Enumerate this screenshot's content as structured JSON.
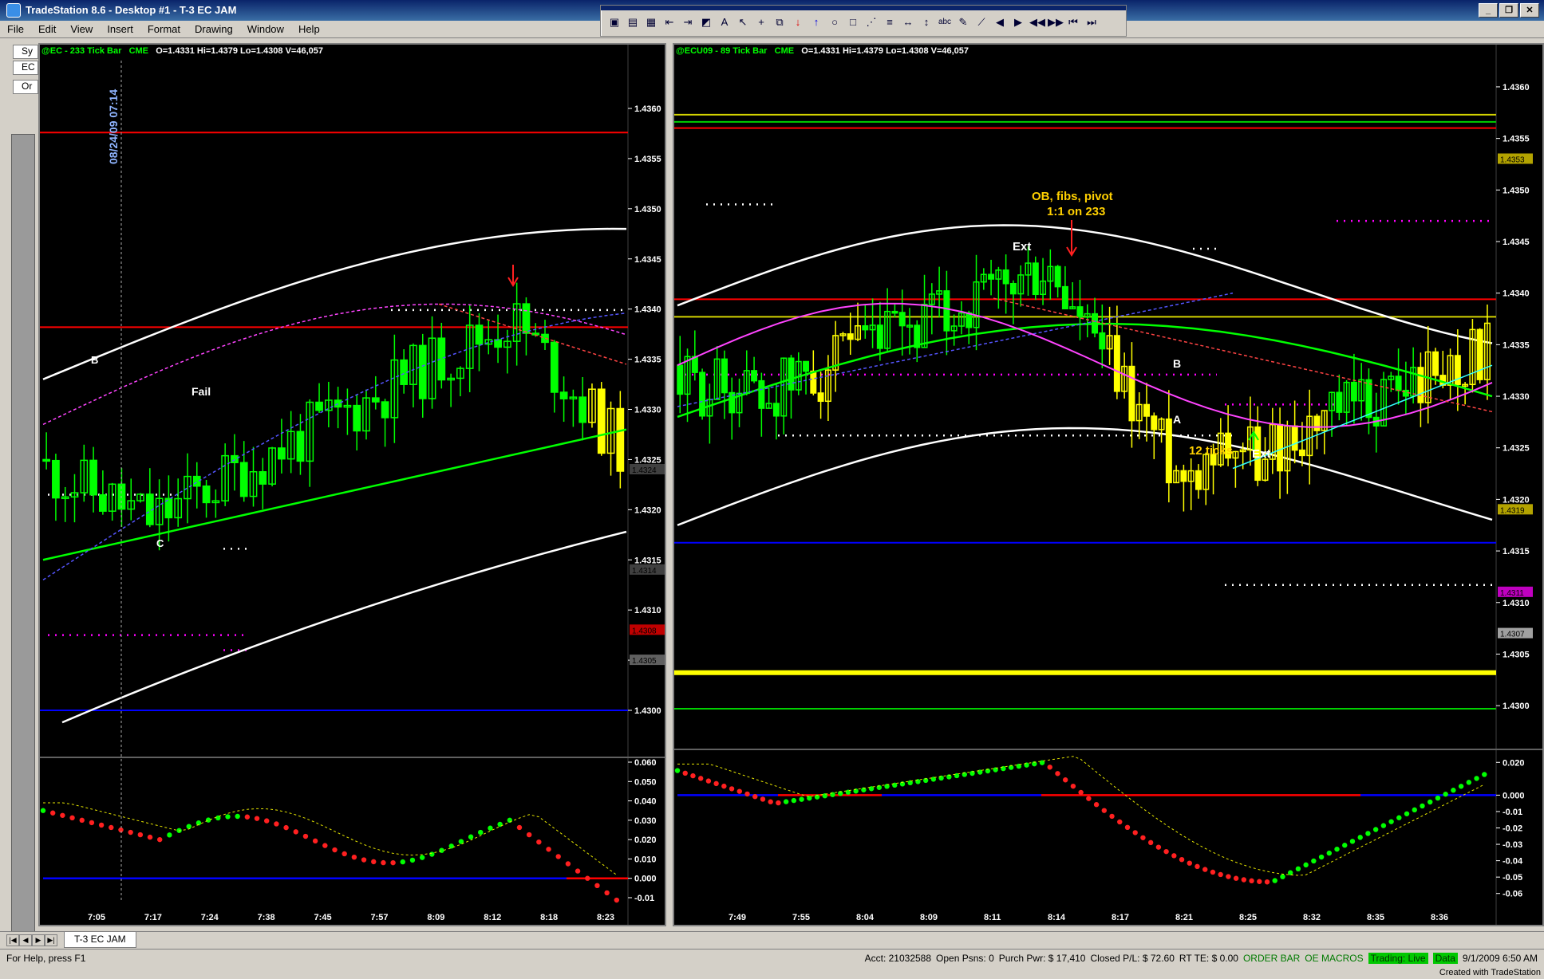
{
  "app": {
    "title": "TradeStation 8.6 - Desktop #1 - T-3 EC JAM"
  },
  "menu": [
    "File",
    "Edit",
    "View",
    "Insert",
    "Format",
    "Drawing",
    "Window",
    "Help"
  ],
  "leftstrip": {
    "items": [
      "Sy",
      "EC",
      "Or"
    ]
  },
  "left_chart": {
    "header": {
      "symbol": "@EC - 233 Tick Bar",
      "exchange": "CME",
      "ohlc": "O=1.4331   Hi=1.4379   Lo=1.4308   V=46,057"
    },
    "date_marker": "08/24/09 07:14",
    "annotations": [
      "B",
      "Fail",
      "C"
    ],
    "price_ticks": [
      "1.4360",
      "1.4355",
      "1.4350",
      "1.4345",
      "1.4340",
      "1.4335",
      "1.4330",
      "1.4325",
      "1.4320",
      "1.4315",
      "1.4310",
      "1.4305",
      "1.4300"
    ],
    "price_flags": [
      "1.4324",
      "1.4314",
      "1.4308",
      "1.4305"
    ],
    "osc_ticks": [
      "0.060",
      "0.050",
      "0.040",
      "0.030",
      "0.020",
      "0.010",
      "0.000",
      "-0.01"
    ],
    "time_ticks": [
      "7:05",
      "7:17",
      "7:24",
      "7:38",
      "7:45",
      "7:57",
      "8:09",
      "8:12",
      "8:18",
      "8:23"
    ]
  },
  "right_chart": {
    "header": {
      "symbol": "@ECU09 - 89 Tick Bar",
      "exchange": "CME",
      "ohlc": "O=1.4331   Hi=1.4379   Lo=1.4308   V=46,057"
    },
    "annotations": {
      "top_line1": "OB, fibs, pivot",
      "top_line2": "1:1 on 233",
      "ext1": "Ext",
      "ext2": "Ext",
      "a": "A",
      "b": "B",
      "ticks": "12 ticks"
    },
    "price_ticks": [
      "1.4360",
      "1.4355",
      "1.4350",
      "1.4345",
      "1.4340",
      "1.4335",
      "1.4330",
      "1.4325",
      "1.4320",
      "1.4315",
      "1.4310",
      "1.4305",
      "1.4300"
    ],
    "price_flags": [
      "1.4353",
      "1.4319",
      "1.4311",
      "1.4307"
    ],
    "osc_ticks": [
      "0.020",
      "0.000",
      "-0.01",
      "-0.02",
      "-0.03",
      "-0.04",
      "-0.05",
      "-0.06"
    ],
    "time_ticks": [
      "7:49",
      "7:55",
      "8:04",
      "8:09",
      "8:11",
      "8:14",
      "8:17",
      "8:21",
      "8:25",
      "8:32",
      "8:35",
      "8:36"
    ]
  },
  "tabs": [
    "T-3 EC JAM"
  ],
  "status": {
    "help": "For Help, press F1",
    "acct": "Acct: 21032588",
    "open_posns": "Open Psns: 0",
    "purch_pwr": "Purch Pwr: $ 17,410",
    "closed_pl": "Closed P/L: $ 72.60",
    "rt_te": "RT TE: $ 0.00",
    "order_bar": "ORDER BAR",
    "oe_macros": "OE MACROS",
    "trading": "Trading: Live",
    "data": "Data",
    "datetime": "9/1/2009 6:50 AM"
  },
  "credit": "Created with TradeStation"
}
